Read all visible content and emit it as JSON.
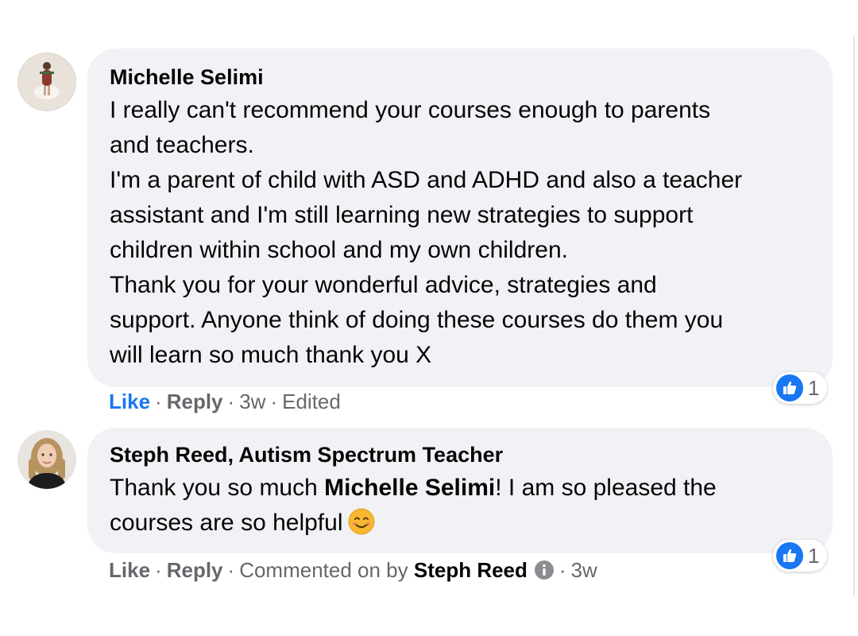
{
  "comments": [
    {
      "author": "Michelle Selimi",
      "lines": [
        "I really can't recommend your courses enough to parents",
        "and teachers.",
        "I'm a parent of child with ASD and ADHD and also a teacher",
        "assistant and I'm still learning new strategies to support",
        "children within school and my own children.",
        "Thank you for your wonderful advice, strategies and",
        "support. Anyone think of doing these courses do them you",
        "will learn so much thank you X"
      ],
      "reaction_count": "1",
      "actions": {
        "like": "Like",
        "reply": "Reply",
        "time": "3w",
        "edited": "Edited",
        "separator": "·"
      }
    },
    {
      "author": "Steph Reed, Autism Spectrum Teacher",
      "text_before": "Thank you so much ",
      "mention": "Michelle Selimi",
      "text_after": "! I am so pleased the",
      "line2": "courses are so helpful",
      "emoji": "smiling-face-icon",
      "reaction_count": "1",
      "actions": {
        "like": "Like",
        "reply": "Reply",
        "commented_on_by": "Commented on by",
        "by_name": "Steph Reed",
        "time": "3w",
        "separator": "·"
      }
    }
  ],
  "colors": {
    "bubble": "#f0f2f5",
    "like_blue": "#1877f2",
    "meta_gray": "#65676b"
  }
}
